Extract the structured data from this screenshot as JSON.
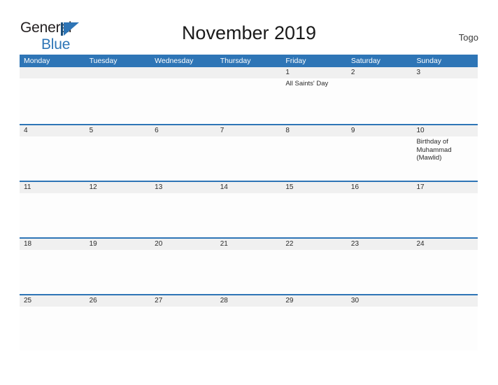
{
  "logo": {
    "word_general": "General",
    "word_blue": "Blue",
    "mark": "triangle-logo-mark"
  },
  "header": {
    "title": "November 2019",
    "country": "Togo"
  },
  "calendar": {
    "weekday_headers": [
      "Monday",
      "Tuesday",
      "Wednesday",
      "Thursday",
      "Friday",
      "Saturday",
      "Sunday"
    ],
    "weeks": [
      {
        "days": [
          {
            "num": "",
            "events": []
          },
          {
            "num": "",
            "events": []
          },
          {
            "num": "",
            "events": []
          },
          {
            "num": "",
            "events": []
          },
          {
            "num": "1",
            "events": [
              "All Saints' Day"
            ]
          },
          {
            "num": "2",
            "events": []
          },
          {
            "num": "3",
            "events": []
          }
        ]
      },
      {
        "days": [
          {
            "num": "4",
            "events": []
          },
          {
            "num": "5",
            "events": []
          },
          {
            "num": "6",
            "events": []
          },
          {
            "num": "7",
            "events": []
          },
          {
            "num": "8",
            "events": []
          },
          {
            "num": "9",
            "events": []
          },
          {
            "num": "10",
            "events": [
              "Birthday of Muhammad (Mawlid)"
            ]
          }
        ]
      },
      {
        "days": [
          {
            "num": "11",
            "events": []
          },
          {
            "num": "12",
            "events": []
          },
          {
            "num": "13",
            "events": []
          },
          {
            "num": "14",
            "events": []
          },
          {
            "num": "15",
            "events": []
          },
          {
            "num": "16",
            "events": []
          },
          {
            "num": "17",
            "events": []
          }
        ]
      },
      {
        "days": [
          {
            "num": "18",
            "events": []
          },
          {
            "num": "19",
            "events": []
          },
          {
            "num": "20",
            "events": []
          },
          {
            "num": "21",
            "events": []
          },
          {
            "num": "22",
            "events": []
          },
          {
            "num": "23",
            "events": []
          },
          {
            "num": "24",
            "events": []
          }
        ]
      },
      {
        "days": [
          {
            "num": "25",
            "events": []
          },
          {
            "num": "26",
            "events": []
          },
          {
            "num": "27",
            "events": []
          },
          {
            "num": "28",
            "events": []
          },
          {
            "num": "29",
            "events": []
          },
          {
            "num": "30",
            "events": []
          },
          {
            "num": "",
            "events": []
          }
        ]
      }
    ]
  },
  "colors": {
    "header_blue": "#2e75b6",
    "rule_blue": "#2e75b6",
    "daynum_band": "#f0f0f0",
    "logo_blue": "#2e75b6",
    "logo_dark": "#231f20",
    "text": "#2a2a2a"
  }
}
